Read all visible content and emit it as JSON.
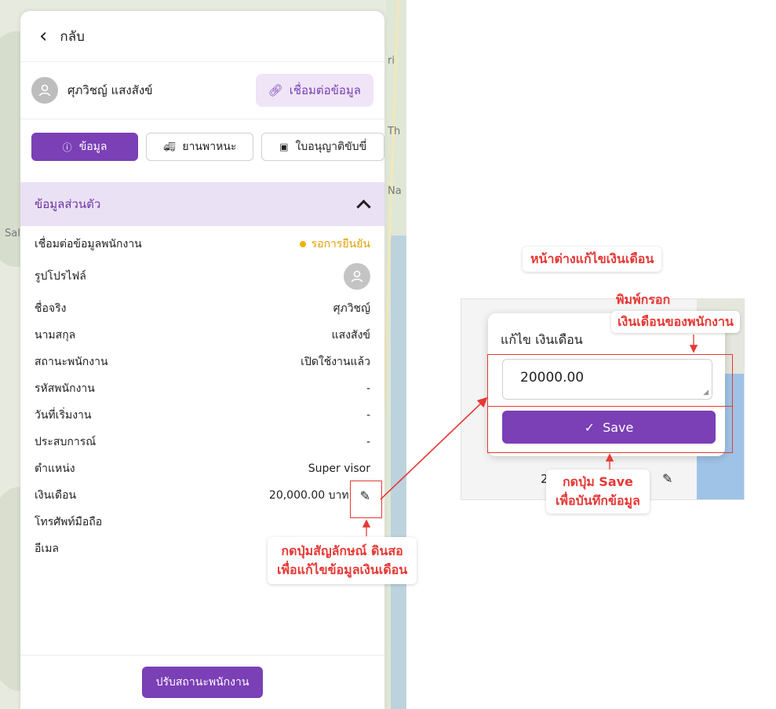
{
  "map": {
    "labels": [
      "Th",
      "Na",
      "Sal",
      "ri"
    ]
  },
  "header": {
    "back_label": "กลับ"
  },
  "user": {
    "name": "ศุภวิชญ์ แสงสังข์",
    "connect_button": "เชื่อมต่อข้อมูล"
  },
  "tabs": [
    {
      "label": "ข้อมูล",
      "icon": "info-icon",
      "active": true
    },
    {
      "label": "ยานพาหนะ",
      "icon": "truck-icon",
      "active": false
    },
    {
      "label": "ใบอนุญาติขับขี่",
      "icon": "id-card-icon",
      "active": false
    }
  ],
  "section": {
    "title": "ข้อมูลส่วนตัว"
  },
  "fields": {
    "connect_label": "เชื่อมต่อข้อมูลพนักงาน",
    "connect_status": "รอการยืนยัน",
    "profile_label": "รูปโปรไฟล์",
    "firstname_label": "ชื่อจริง",
    "firstname_value": "ศุภวิชญ์",
    "lastname_label": "นามสกุล",
    "lastname_value": "แสงสังข์",
    "status_label": "สถานะพนักงาน",
    "status_value": "เปิดใช้งานแล้ว",
    "code_label": "รหัสพนักงาน",
    "code_value": "-",
    "start_label": "วันที่เริ่มงาน",
    "start_value": "-",
    "exp_label": "ประสบการณ์",
    "exp_value": "-",
    "position_label": "ตำแหน่ง",
    "position_value": "Super visor",
    "salary_label": "เงินเดือน",
    "salary_value": "20,000.00 บาท",
    "phone_label": "โทรศัพท์มือถือ",
    "email_label": "อีเมล"
  },
  "footer": {
    "adjust_button": "ปรับสถานะพนักงาน"
  },
  "dialog": {
    "title": "แก้ไข เงินเดือน",
    "input_value": "20000.00",
    "save_label": "Save",
    "under_text": "2"
  },
  "annotations": {
    "edit_hint_line1": "กดปุ่มสัญลักษณ์ ดินสอ",
    "edit_hint_line2": "เพื่อแก้ไขข้อมูลเงินเดือน",
    "window_title": "หน้าต่างแก้ไขเงินเดือน",
    "type_hint_line1": "พิมพ์กรอก",
    "type_hint_line2": "เงินเดือนของพนักงาน",
    "save_hint_line1": "กดปุ่ม Save",
    "save_hint_line2": "เพื่อบันทึกข้อมูล"
  },
  "colors": {
    "primary": "#7b3fb6",
    "section_bg": "#ebe1f4",
    "annotation_red": "#e53935",
    "pending": "#f1b000"
  }
}
